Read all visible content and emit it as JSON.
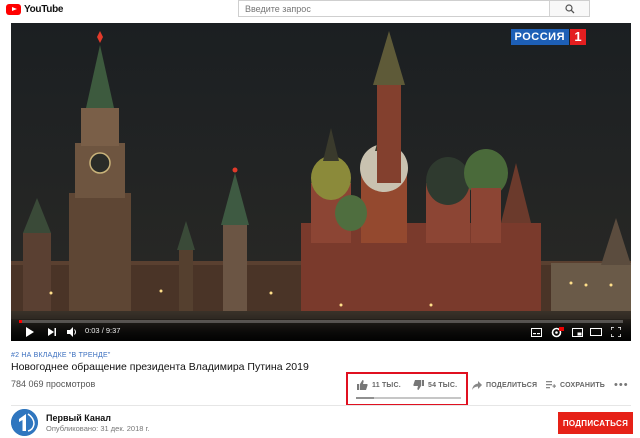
{
  "header": {
    "logo_text": "YouTube",
    "search_placeholder": "Введите запрос"
  },
  "video": {
    "badge_word": "РОССИЯ",
    "badge_number": "1",
    "current_time": "0:03",
    "duration": "9:37",
    "time_separator": " / ",
    "progress_fraction": 0.005
  },
  "info": {
    "trending": "#2 НА ВКЛАДКЕ \"В ТРЕНДЕ\"",
    "title": "Новогоднее обращение президента Владимира Путина 2019",
    "views": "784 069 просмотров"
  },
  "actions": {
    "likes": "11 ТЫС.",
    "dislikes": "54 ТЫС.",
    "share": "ПОДЕЛИТЬСЯ",
    "save": "СОХРАНИТЬ",
    "more": "•••",
    "like_fraction": 0.17
  },
  "channel": {
    "name": "Первый Канал",
    "published": "Опубликовано: 31 дек. 2018 г.",
    "subscribe": "ПОДПИСАТЬСЯ"
  },
  "colors": {
    "brand_red": "#ff0000",
    "subscribe_red": "#e62117",
    "highlight_box": "#e01020",
    "link_blue": "#3b6fbf"
  },
  "icons": [
    "youtube-logo-icon",
    "search-icon",
    "play-icon",
    "next-icon",
    "volume-icon",
    "subtitles-icon",
    "settings-icon",
    "miniplayer-icon",
    "fullscreen-icon",
    "thumbs-up-icon",
    "thumbs-down-icon",
    "share-icon",
    "save-playlist-icon",
    "more-icon",
    "channel-avatar-icon"
  ]
}
